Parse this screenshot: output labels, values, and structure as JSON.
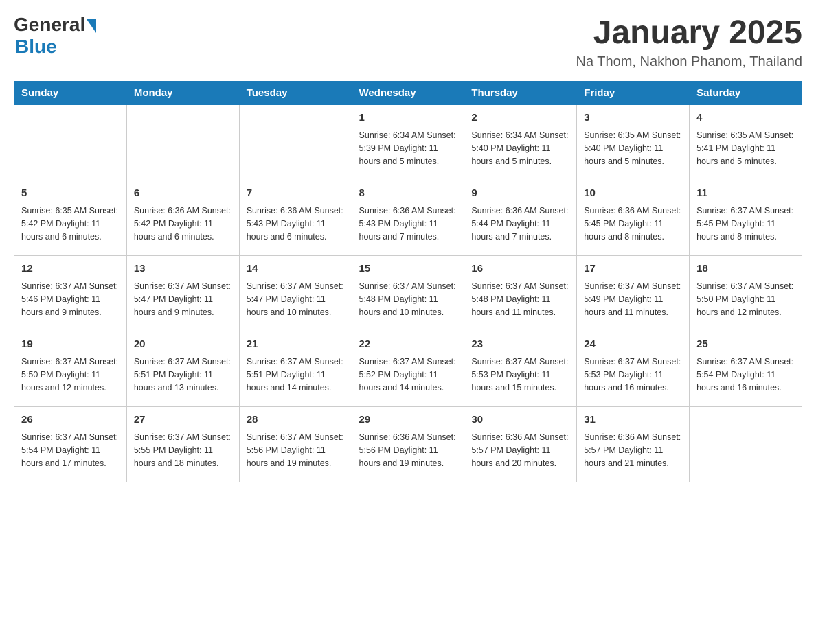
{
  "header": {
    "logo_general": "General",
    "logo_blue": "Blue",
    "title": "January 2025",
    "subtitle": "Na Thom, Nakhon Phanom, Thailand"
  },
  "weekdays": [
    "Sunday",
    "Monday",
    "Tuesday",
    "Wednesday",
    "Thursday",
    "Friday",
    "Saturday"
  ],
  "weeks": [
    [
      {
        "day": "",
        "info": ""
      },
      {
        "day": "",
        "info": ""
      },
      {
        "day": "",
        "info": ""
      },
      {
        "day": "1",
        "info": "Sunrise: 6:34 AM\nSunset: 5:39 PM\nDaylight: 11 hours\nand 5 minutes."
      },
      {
        "day": "2",
        "info": "Sunrise: 6:34 AM\nSunset: 5:40 PM\nDaylight: 11 hours\nand 5 minutes."
      },
      {
        "day": "3",
        "info": "Sunrise: 6:35 AM\nSunset: 5:40 PM\nDaylight: 11 hours\nand 5 minutes."
      },
      {
        "day": "4",
        "info": "Sunrise: 6:35 AM\nSunset: 5:41 PM\nDaylight: 11 hours\nand 5 minutes."
      }
    ],
    [
      {
        "day": "5",
        "info": "Sunrise: 6:35 AM\nSunset: 5:42 PM\nDaylight: 11 hours\nand 6 minutes."
      },
      {
        "day": "6",
        "info": "Sunrise: 6:36 AM\nSunset: 5:42 PM\nDaylight: 11 hours\nand 6 minutes."
      },
      {
        "day": "7",
        "info": "Sunrise: 6:36 AM\nSunset: 5:43 PM\nDaylight: 11 hours\nand 6 minutes."
      },
      {
        "day": "8",
        "info": "Sunrise: 6:36 AM\nSunset: 5:43 PM\nDaylight: 11 hours\nand 7 minutes."
      },
      {
        "day": "9",
        "info": "Sunrise: 6:36 AM\nSunset: 5:44 PM\nDaylight: 11 hours\nand 7 minutes."
      },
      {
        "day": "10",
        "info": "Sunrise: 6:36 AM\nSunset: 5:45 PM\nDaylight: 11 hours\nand 8 minutes."
      },
      {
        "day": "11",
        "info": "Sunrise: 6:37 AM\nSunset: 5:45 PM\nDaylight: 11 hours\nand 8 minutes."
      }
    ],
    [
      {
        "day": "12",
        "info": "Sunrise: 6:37 AM\nSunset: 5:46 PM\nDaylight: 11 hours\nand 9 minutes."
      },
      {
        "day": "13",
        "info": "Sunrise: 6:37 AM\nSunset: 5:47 PM\nDaylight: 11 hours\nand 9 minutes."
      },
      {
        "day": "14",
        "info": "Sunrise: 6:37 AM\nSunset: 5:47 PM\nDaylight: 11 hours\nand 10 minutes."
      },
      {
        "day": "15",
        "info": "Sunrise: 6:37 AM\nSunset: 5:48 PM\nDaylight: 11 hours\nand 10 minutes."
      },
      {
        "day": "16",
        "info": "Sunrise: 6:37 AM\nSunset: 5:48 PM\nDaylight: 11 hours\nand 11 minutes."
      },
      {
        "day": "17",
        "info": "Sunrise: 6:37 AM\nSunset: 5:49 PM\nDaylight: 11 hours\nand 11 minutes."
      },
      {
        "day": "18",
        "info": "Sunrise: 6:37 AM\nSunset: 5:50 PM\nDaylight: 11 hours\nand 12 minutes."
      }
    ],
    [
      {
        "day": "19",
        "info": "Sunrise: 6:37 AM\nSunset: 5:50 PM\nDaylight: 11 hours\nand 12 minutes."
      },
      {
        "day": "20",
        "info": "Sunrise: 6:37 AM\nSunset: 5:51 PM\nDaylight: 11 hours\nand 13 minutes."
      },
      {
        "day": "21",
        "info": "Sunrise: 6:37 AM\nSunset: 5:51 PM\nDaylight: 11 hours\nand 14 minutes."
      },
      {
        "day": "22",
        "info": "Sunrise: 6:37 AM\nSunset: 5:52 PM\nDaylight: 11 hours\nand 14 minutes."
      },
      {
        "day": "23",
        "info": "Sunrise: 6:37 AM\nSunset: 5:53 PM\nDaylight: 11 hours\nand 15 minutes."
      },
      {
        "day": "24",
        "info": "Sunrise: 6:37 AM\nSunset: 5:53 PM\nDaylight: 11 hours\nand 16 minutes."
      },
      {
        "day": "25",
        "info": "Sunrise: 6:37 AM\nSunset: 5:54 PM\nDaylight: 11 hours\nand 16 minutes."
      }
    ],
    [
      {
        "day": "26",
        "info": "Sunrise: 6:37 AM\nSunset: 5:54 PM\nDaylight: 11 hours\nand 17 minutes."
      },
      {
        "day": "27",
        "info": "Sunrise: 6:37 AM\nSunset: 5:55 PM\nDaylight: 11 hours\nand 18 minutes."
      },
      {
        "day": "28",
        "info": "Sunrise: 6:37 AM\nSunset: 5:56 PM\nDaylight: 11 hours\nand 19 minutes."
      },
      {
        "day": "29",
        "info": "Sunrise: 6:36 AM\nSunset: 5:56 PM\nDaylight: 11 hours\nand 19 minutes."
      },
      {
        "day": "30",
        "info": "Sunrise: 6:36 AM\nSunset: 5:57 PM\nDaylight: 11 hours\nand 20 minutes."
      },
      {
        "day": "31",
        "info": "Sunrise: 6:36 AM\nSunset: 5:57 PM\nDaylight: 11 hours\nand 21 minutes."
      },
      {
        "day": "",
        "info": ""
      }
    ]
  ]
}
